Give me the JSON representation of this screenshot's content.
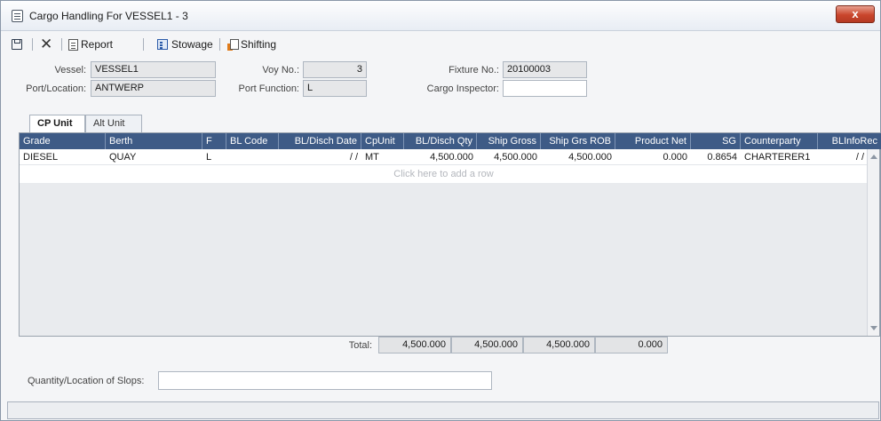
{
  "window": {
    "title": "Cargo Handling For VESSEL1 - 3",
    "close_label": "x"
  },
  "toolbar": {
    "report": "Report",
    "stowage": "Stowage",
    "shifting": "Shifting"
  },
  "form": {
    "vessel_label": "Vessel:",
    "vessel": "VESSEL1",
    "port_label": "Port/Location:",
    "port": "ANTWERP",
    "voy_label": "Voy No.:",
    "voy": "3",
    "portfn_label": "Port Function:",
    "portfn": "L",
    "fixture_label": "Fixture No.:",
    "fixture": "20100003",
    "inspector_label": "Cargo Inspector:",
    "inspector": ""
  },
  "tabs": [
    {
      "label": "CP Unit"
    },
    {
      "label": "Alt Unit"
    }
  ],
  "grid": {
    "headers": [
      "Grade",
      "Berth",
      "F",
      "BL Code",
      "BL/Disch Date",
      "CpUnit",
      "BL/Disch Qty",
      "Ship Gross",
      "Ship Grs ROB",
      "Product Net",
      "SG",
      "Counterparty",
      "BLInfoRec"
    ],
    "rows": [
      [
        "DIESEL",
        "QUAY",
        "L",
        "",
        "/ /",
        "MT",
        "4,500.000",
        "4,500.000",
        "4,500.000",
        "0.000",
        "0.8654",
        "CHARTERER1",
        "/ /"
      ]
    ],
    "add_row_text": "Click here to add a row"
  },
  "totals": {
    "label": "Total:",
    "values": [
      "4,500.000",
      "4,500.000",
      "4,500.000",
      "0.000"
    ]
  },
  "slops": {
    "label": "Quantity/Location of Slops:",
    "value": ""
  }
}
